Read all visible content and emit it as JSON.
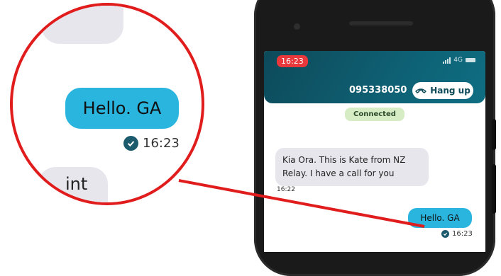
{
  "status_bar": {
    "time": "16:23",
    "network": "4G"
  },
  "call": {
    "number": "095338050",
    "hangup_label": "Hang up",
    "status": "Connected"
  },
  "messages": [
    {
      "direction": "incoming",
      "text": "Kia Ora. This is Kate from NZ Relay. I have a call for you",
      "time": "16:22"
    },
    {
      "direction": "outgoing",
      "text": "Hello. GA",
      "time": "16:23"
    }
  ],
  "zoom": {
    "partial_text": "int"
  },
  "colors": {
    "header": "#0e5a6b",
    "outgoing_bubble": "#2ab5df",
    "incoming_bubble": "#e6e6ec",
    "connected": "#d5ecc4",
    "time_pill": "#e8383c",
    "annotation": "#e01c1c"
  },
  "icons": [
    "phone-hangup-icon",
    "checkmark-icon",
    "signal-icon",
    "battery-icon",
    "camera-icon"
  ]
}
